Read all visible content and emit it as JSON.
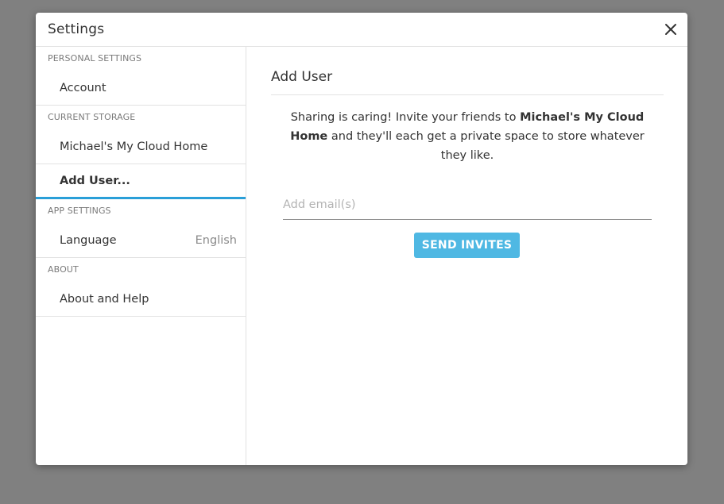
{
  "dialog": {
    "title": "Settings",
    "close_icon": "close-icon"
  },
  "sidebar": {
    "sections": [
      {
        "header": "PERSONAL SETTINGS",
        "items": [
          {
            "label": "Account"
          }
        ]
      },
      {
        "header": "CURRENT STORAGE",
        "items": [
          {
            "label": "Michael's My Cloud Home"
          },
          {
            "label": "Add User...",
            "active": true
          }
        ]
      },
      {
        "header": "APP SETTINGS",
        "items": [
          {
            "label": "Language",
            "value": "English"
          }
        ]
      },
      {
        "header": "ABOUT",
        "items": [
          {
            "label": "About and Help"
          }
        ]
      }
    ]
  },
  "main": {
    "title": "Add User",
    "invite_text_before": "Sharing is caring! Invite your friends to ",
    "invite_text_bold": "Michael's My Cloud Home",
    "invite_text_after": " and they'll each get a private space to store whatever they like.",
    "email_input": {
      "value": "",
      "placeholder": "Add email(s)"
    },
    "send_button_label": "SEND INVITES"
  },
  "colors": {
    "backdrop": "#808080",
    "accent": "#2a9fd8",
    "button": "#4fb8e3"
  }
}
